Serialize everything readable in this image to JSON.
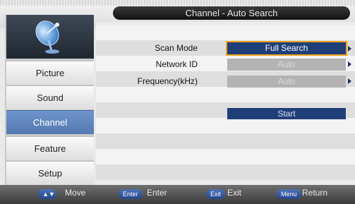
{
  "header": {
    "title": "Channel - Auto Search"
  },
  "sidebar": {
    "icon": "satellite-dish-icon",
    "items": [
      {
        "label": "Picture",
        "active": false
      },
      {
        "label": "Sound",
        "active": false
      },
      {
        "label": "Channel",
        "active": true
      },
      {
        "label": "Feature",
        "active": false
      },
      {
        "label": "Setup",
        "active": false
      }
    ]
  },
  "settings": {
    "rows": [
      {
        "label": "Scan Mode",
        "value": "Full Search"
      },
      {
        "label": "Network ID",
        "value": "Auto"
      },
      {
        "label": "Frequency(kHz)",
        "value": "Auto"
      }
    ],
    "start_label": "Start"
  },
  "footer": {
    "keys": [
      {
        "key": "▲▼",
        "label": "Move"
      },
      {
        "key": "Enter",
        "label": "Enter"
      },
      {
        "key": "Exit",
        "label": "Exit"
      },
      {
        "key": "Menu",
        "label": "Return"
      }
    ]
  },
  "colors": {
    "accent": "#5479b1",
    "selection": "#1f3f78",
    "focus_border": "#f2a21a"
  }
}
